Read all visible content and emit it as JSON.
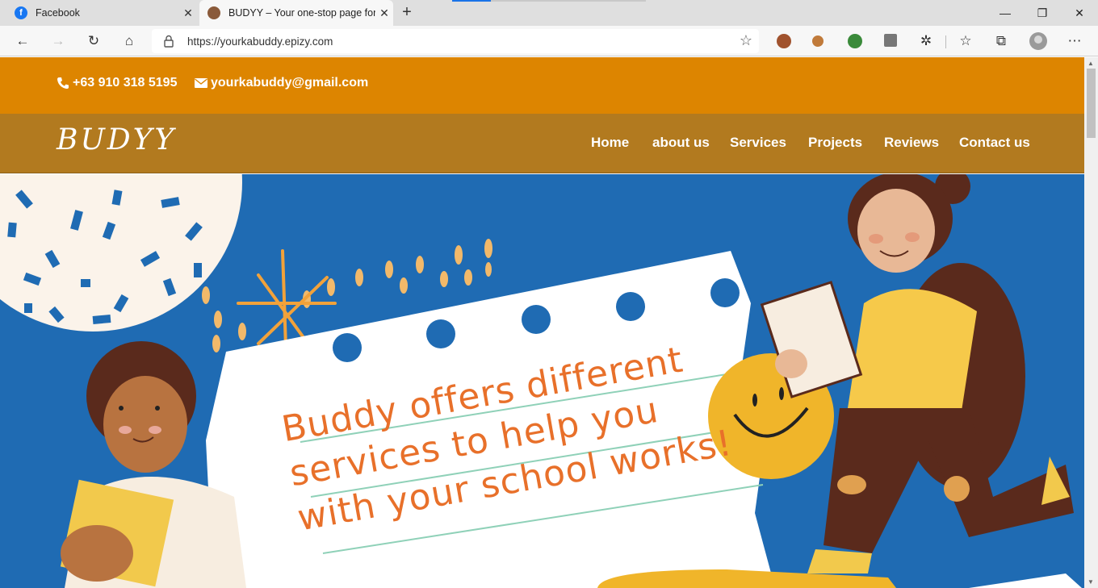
{
  "browser": {
    "tabs": [
      {
        "title": "Facebook",
        "favicon": "facebook-icon",
        "color": "#1877f2"
      },
      {
        "title": "BUDYY – Your one-stop page for",
        "favicon": "budyy-favicon",
        "color": "#8a5a3a"
      }
    ],
    "url": "https://yourkabuddy.epizy.com"
  },
  "site": {
    "phone": "+63 910 318 5195",
    "email": "yourkabuddy@gmail.com",
    "logo": "BUDYY",
    "nav": [
      "Home",
      "about us",
      "Services",
      "Projects",
      "Reviews",
      "Contact us"
    ],
    "hero_lines": [
      "Buddy offers different",
      "services to help you",
      "with your school works!"
    ]
  },
  "colors": {
    "topbar": "#dd8500",
    "navbar": "#b27a1f",
    "hero_bg": "#1f6bb3",
    "hero_text": "#e8702a"
  }
}
